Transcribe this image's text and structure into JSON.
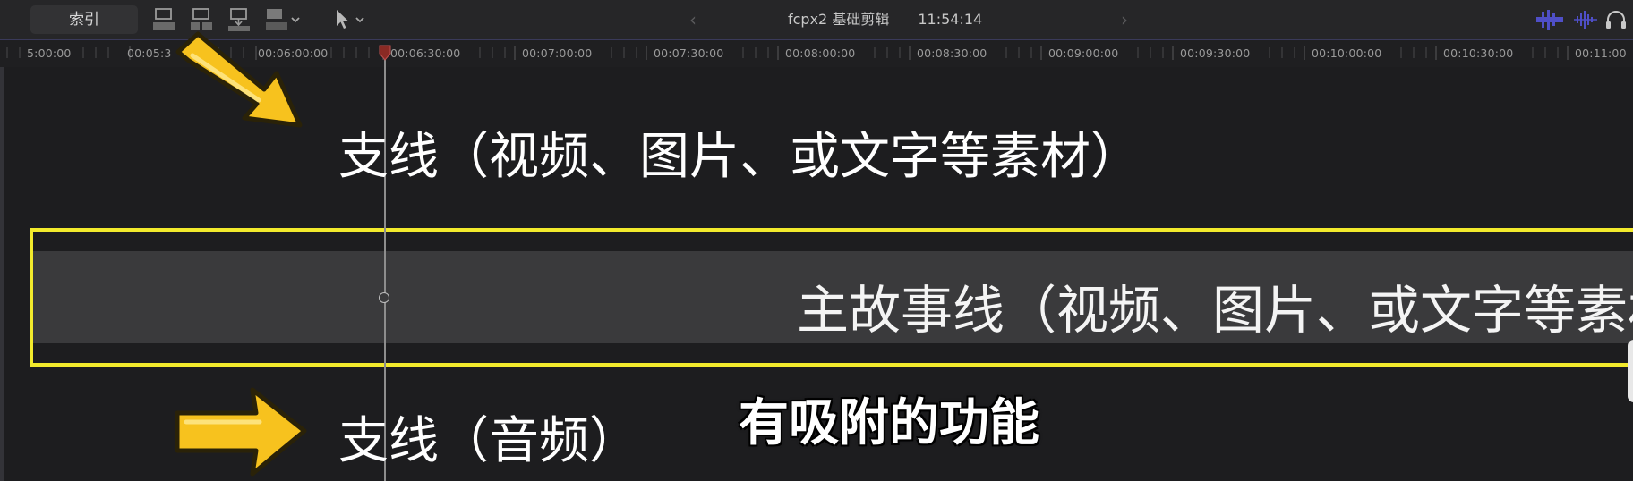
{
  "toolbar": {
    "index_label": "索引",
    "project_name": "fcpx2 基础剪辑",
    "timecode": "11:54:14",
    "icons": [
      "clip-append-icon",
      "clip-insert-icon",
      "clip-overwrite-icon",
      "clip-connect-icon",
      "select-tool-icon",
      "back-chevron-icon",
      "forward-chevron-icon",
      "audio-meter-icon",
      "audio-waveform-icon",
      "headphones-icon"
    ]
  },
  "ruler": {
    "labels": [
      "5:00:00",
      "00:05:3",
      "00:06:00:00",
      "00:06:30:00",
      "00:07:00:00",
      "00:07:30:00",
      "00:08:00:00",
      "00:08:30:00",
      "00:09:00:00",
      "00:09:30:00",
      "00:10:00:00",
      "00:10:30:00",
      "00:11:00"
    ]
  },
  "captions": {
    "connected_top": "支线（视频、图片、或文字等素材）",
    "primary_storyline": "主故事线（视频、图片、或文字等素材",
    "connected_audio": "支线（音频）",
    "snapping_note": "有吸附的功能"
  },
  "colors": {
    "highlight": "#f2ea2c",
    "arrow_fill": "#f7c21e",
    "background": "#1d1d1f",
    "audio_accent": "#4f4fc8"
  }
}
